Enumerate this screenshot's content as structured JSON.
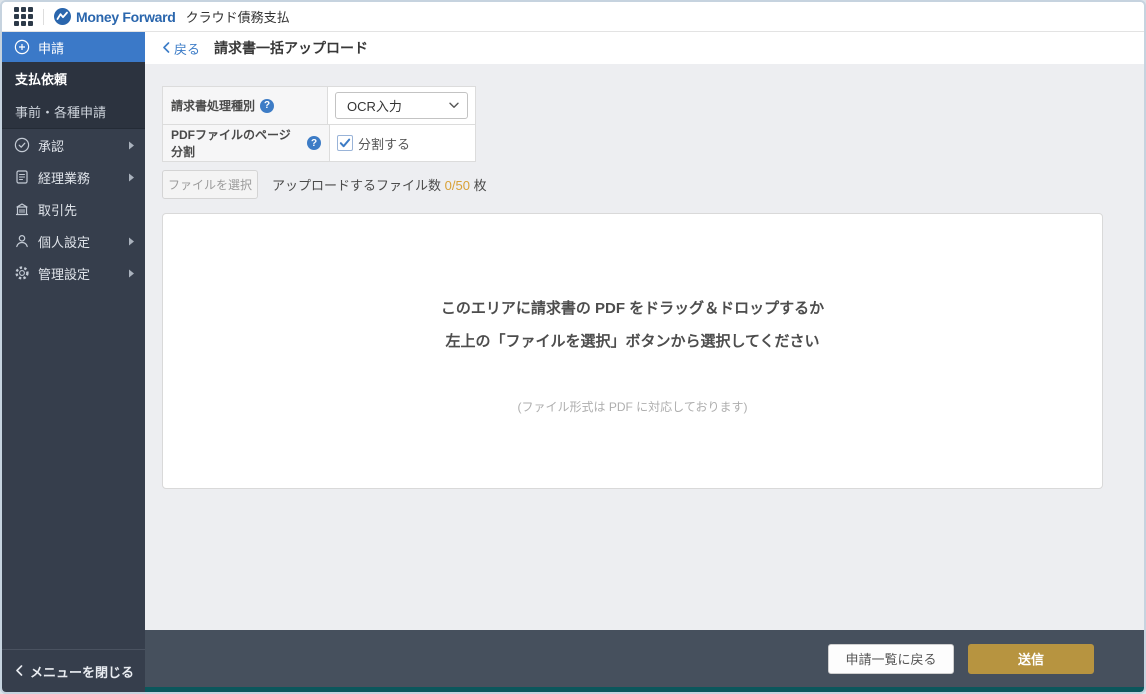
{
  "header": {
    "brand": "Money Forward",
    "product": "クラウド債務支払"
  },
  "sidebar": {
    "active_item": {
      "label": "申請"
    },
    "sub_items": [
      {
        "label": "支払依頼"
      },
      {
        "label": "事前・各種申請"
      }
    ],
    "items": [
      {
        "label": "承認",
        "expandable": true
      },
      {
        "label": "経理業務",
        "expandable": true
      },
      {
        "label": "取引先",
        "expandable": false
      },
      {
        "label": "個人設定",
        "expandable": true
      },
      {
        "label": "管理設定",
        "expandable": true
      }
    ],
    "close_menu_label": "メニューを閉じる"
  },
  "breadcrumb": {
    "back_label": "戻る",
    "page_title": "請求書一括アップロード"
  },
  "form": {
    "rows": [
      {
        "label": "請求書処理種別",
        "value": "OCR入力"
      },
      {
        "label": "PDFファイルのページ分割",
        "checkbox_label": "分割する",
        "checked": true
      }
    ],
    "file_select_button": "ファイルを選択",
    "upload_count_prefix": "アップロードするファイル数",
    "upload_count": "0/50",
    "upload_count_suffix": "枚",
    "help_glyph": "?"
  },
  "dropzone": {
    "line1": "このエリアに請求書の PDF をドラッグ＆ドロップするか",
    "line2": "左上の「ファイルを選択」ボタンから選択してください",
    "note": "(ファイル形式は PDF に対応しております)"
  },
  "footer": {
    "back_to_list_button": "申請一覧に戻る",
    "submit_button": "送信"
  },
  "colors": {
    "accent_blue": "#3b79c8",
    "sidebar_dark": "#363e4c",
    "submenu_dark": "#2c333f",
    "footer_dark": "#46505d",
    "teal_accent": "#0b575c",
    "gold": "#b79440",
    "count_orange": "#d9a136",
    "logo_blue": "#2a66ad"
  }
}
